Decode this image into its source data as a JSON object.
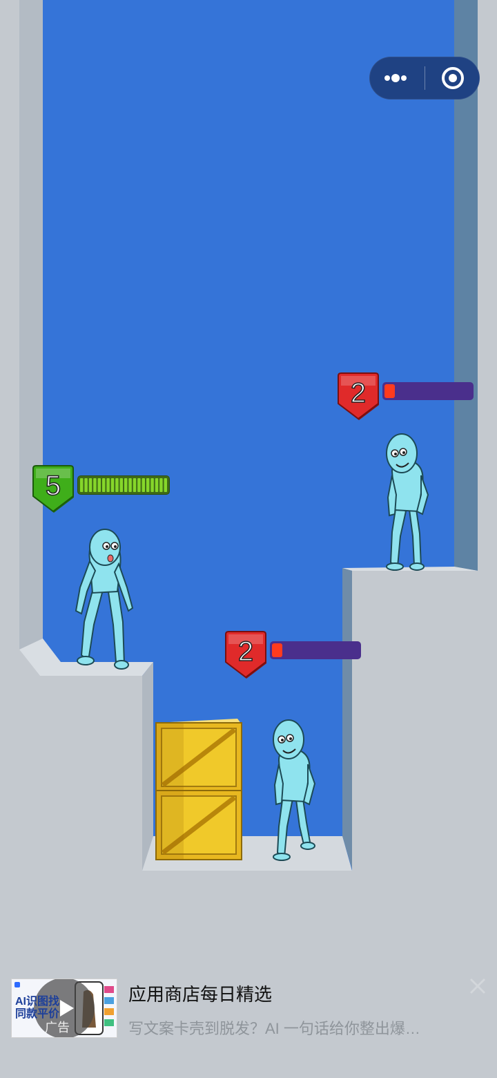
{
  "capsule": {
    "menu_icon": "more-dots-icon",
    "close_icon": "target-circle-icon"
  },
  "player": {
    "level": "5",
    "health_fraction": 1.0,
    "badge_color": "#3fae1a",
    "bar_color": "#86d62a"
  },
  "enemies": [
    {
      "level": "2",
      "health_fraction": 0.12,
      "badge_color": "#e02a2a",
      "bar_color": "#ff3b1e"
    },
    {
      "level": "2",
      "health_fraction": 0.12,
      "badge_color": "#e02a2a",
      "bar_color": "#ff3b1e"
    }
  ],
  "ad": {
    "title": "应用商店每日精选",
    "description": "写文案卡壳到脱发？AI 一句话给你整出爆…",
    "thumb_text_1": "AI识图找",
    "thumb_text_2": "同款平价",
    "ad_label": "广告",
    "close_icon": "close-icon"
  },
  "colors": {
    "sky": "#3574d8",
    "wall": "#c4c9cf",
    "crate": "#f0c92a"
  }
}
